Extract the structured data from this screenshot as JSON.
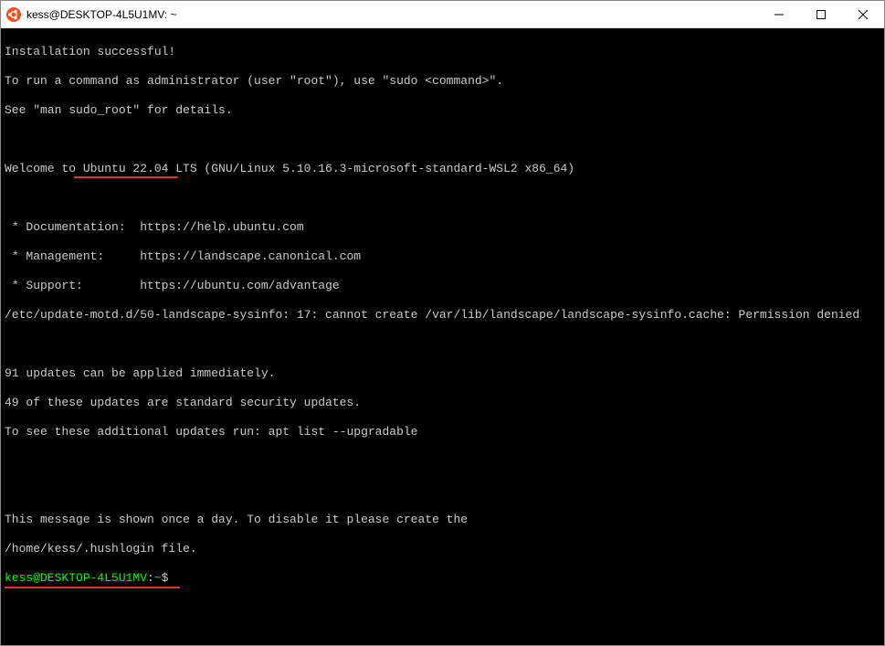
{
  "window": {
    "title": "kess@DESKTOP-4L5U1MV: ~"
  },
  "terminal": {
    "lines": {
      "install_success": "Installation successful!",
      "run_as_admin": "To run a command as administrator (user \"root\"), use \"sudo <command>\".",
      "see_man": "See \"man sudo_root\" for details.",
      "welcome": "Welcome to Ubuntu 22.04 LTS (GNU/Linux 5.10.16.3-microsoft-standard-WSL2 x86_64)",
      "doc": " * Documentation:  https://help.ubuntu.com",
      "mgmt": " * Management:     https://landscape.canonical.com",
      "support": " * Support:        https://ubuntu.com/advantage",
      "motd_error": "/etc/update-motd.d/50-landscape-sysinfo: 17: cannot create /var/lib/landscape/landscape-sysinfo.cache: Permission denied",
      "updates1": "91 updates can be applied immediately.",
      "updates2": "49 of these updates are standard security updates.",
      "updates3": "To see these additional updates run: apt list --upgradable",
      "msg_daily": "This message is shown once a day. To disable it please create the",
      "hushlogin": "/home/kess/.hushlogin file."
    },
    "prompt": {
      "userhost": "kess@DESKTOP-4L5U1MV",
      "colon": ":",
      "path": "~",
      "dollar": "$"
    }
  }
}
